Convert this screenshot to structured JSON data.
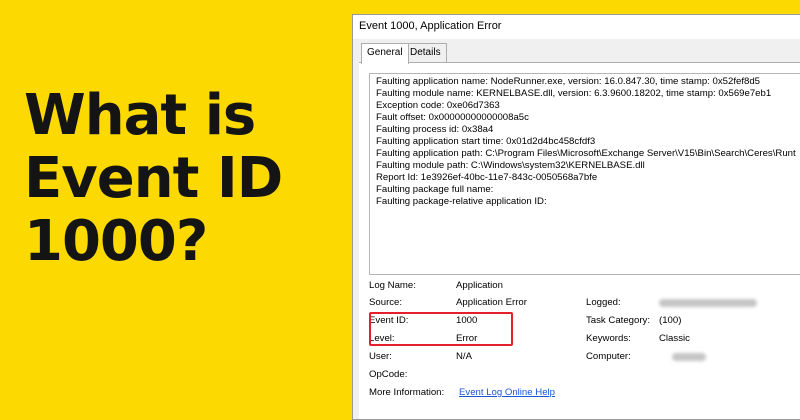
{
  "hero": {
    "lines": [
      "What is",
      "Event ID",
      "1000?"
    ]
  },
  "window": {
    "title": "Event 1000, Application Error",
    "tabs": [
      "General",
      "Details"
    ]
  },
  "description": [
    "Faulting application name: NodeRunner.exe, version: 16.0.847.30, time stamp: 0x52fef8d5",
    "Faulting module name: KERNELBASE.dll, version: 6.3.9600.18202, time stamp: 0x569e7eb1",
    "Exception code: 0xe06d7363",
    "Fault offset: 0x00000000000008a5c",
    "Faulting process id: 0x38a4",
    "Faulting application start time: 0x01d2d4bc458cfdf3",
    "Faulting application path: C:\\Program Files\\Microsoft\\Exchange Server\\V15\\Bin\\Search\\Ceres\\Runt",
    "Faulting module path: C:\\Windows\\system32\\KERNELBASE.dll",
    "Report Id: 1e3926ef-40bc-11e7-843c-0050568a7bfe",
    "Faulting package full name:",
    "Faulting package-relative application ID:"
  ],
  "fields": {
    "log_name_label": "Log Name:",
    "log_name_value": "Application",
    "source_label": "Source:",
    "source_value": "Application Error",
    "logged_label": "Logged:",
    "event_id_label": "Event ID:",
    "event_id_value": "1000",
    "task_category_label": "Task Category:",
    "task_category_value": "(100)",
    "level_label": "Level:",
    "level_value": "Error",
    "keywords_label": "Keywords:",
    "keywords_value": "Classic",
    "user_label": "User:",
    "user_value": "N/A",
    "computer_label": "Computer:",
    "opcode_label": "OpCode:",
    "more_info_label": "More Information:",
    "more_info_link": "Event Log Online Help"
  },
  "colors": {
    "background": "#fcd900",
    "highlight": "#e4212b",
    "link": "#1a56d6"
  }
}
